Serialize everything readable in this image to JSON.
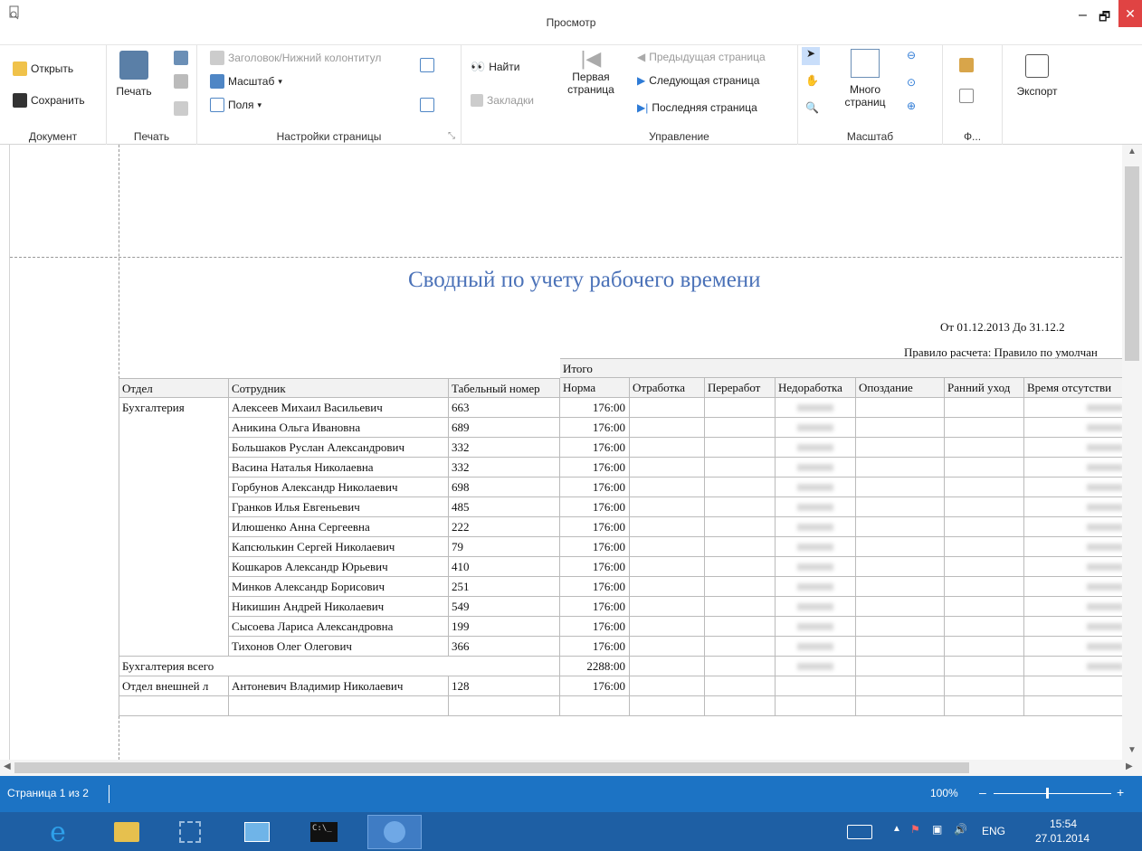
{
  "window": {
    "title": "Просмотр",
    "minimize": "–",
    "maximize": "🗗",
    "close": "✕"
  },
  "ribbon": {
    "document": {
      "label": "Документ",
      "open": "Открыть",
      "save": "Сохранить"
    },
    "print": {
      "label": "Печать",
      "print": "Печать"
    },
    "page_settings": {
      "label": "Настройки страницы",
      "header_footer": "Заголовок/Нижний колонтитул",
      "scale": "Масштаб",
      "margins": "Поля",
      "launcher": "⤡"
    },
    "find": {
      "find": "Найти",
      "bookmarks": "Закладки"
    },
    "navigation": {
      "label": "Управление",
      "first_page": "Первая страница",
      "first_line1": "Первая",
      "first_line2": "страница",
      "prev_page": "Предыдущая страница",
      "next_page": "Следующая страница",
      "last_page": "Последняя страница"
    },
    "zoom": {
      "label": "Масштаб",
      "many_pages_1": "Много",
      "many_pages_2": "страниц"
    },
    "format": {
      "label": "Ф..."
    },
    "export": {
      "label": "Экспорт"
    }
  },
  "report": {
    "title": "Сводный по учету рабочего времени",
    "date_range": "От 01.12.2013 До 31.12.2",
    "rule": "Правило расчета: Правило по умолчан",
    "group_header": "Итого",
    "columns": [
      "Отдел",
      "Сотрудник",
      "Табельный номер",
      "Норма",
      "Отработка",
      "Переработ",
      "Недоработка",
      "Опоздание",
      "Ранний уход",
      "Время отсутстви"
    ],
    "rows": [
      {
        "dept": "Бухгалтерия",
        "name": "Алексеев Михаил Васильевич",
        "num": "663",
        "norm": "176:00"
      },
      {
        "dept": "",
        "name": "Аникина Ольга Ивановна",
        "num": "689",
        "norm": "176:00"
      },
      {
        "dept": "",
        "name": "Большаков Руслан Александрович",
        "num": "332",
        "norm": "176:00"
      },
      {
        "dept": "",
        "name": "Васина Наталья Николаевна",
        "num": "332",
        "norm": "176:00"
      },
      {
        "dept": "",
        "name": "Горбунов Александр Николаевич",
        "num": "698",
        "norm": "176:00"
      },
      {
        "dept": "",
        "name": "Гранков Илья Евгеньевич",
        "num": "485",
        "norm": "176:00"
      },
      {
        "dept": "",
        "name": "Илюшенко Анна Сергеевна",
        "num": "222",
        "norm": "176:00"
      },
      {
        "dept": "",
        "name": "Капсюлькин Сергей Николаевич",
        "num": "79",
        "norm": "176:00"
      },
      {
        "dept": "",
        "name": "Кошкаров Александр Юрьевич",
        "num": "410",
        "norm": "176:00"
      },
      {
        "dept": "",
        "name": "Минков Александр Борисович",
        "num": "251",
        "norm": "176:00"
      },
      {
        "dept": "",
        "name": "Никишин Андрей Николаевич",
        "num": "549",
        "norm": "176:00"
      },
      {
        "dept": "",
        "name": "Сысоева Лариса Александровна",
        "num": "199",
        "norm": "176:00"
      },
      {
        "dept": "",
        "name": "Тихонов Олег Олегович",
        "num": "366",
        "norm": "176:00"
      }
    ],
    "total": {
      "label": "Бухгалтерия всего",
      "norm": "2288:00"
    },
    "next_row": {
      "dept": "Отдел внешней л",
      "name": "Антоневич Владимир Николаевич",
      "num": "128",
      "norm": "176:00"
    }
  },
  "status": {
    "page": "Страница 1 из 2",
    "zoom": "100%",
    "zoom_minus": "–",
    "zoom_plus": "+"
  },
  "taskbar": {
    "lang": "ENG",
    "time": "15:54",
    "date": "27.01.2014"
  }
}
